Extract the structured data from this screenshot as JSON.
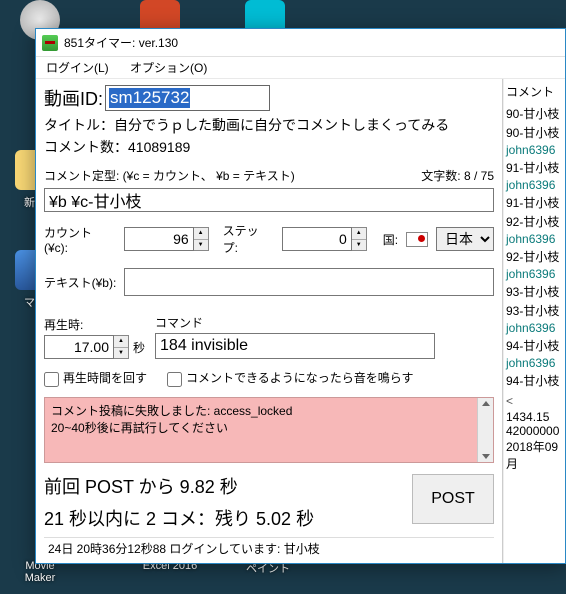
{
  "desktop": {
    "trash": "",
    "ppt": "",
    "newfolder": "新し",
    "mycomp": "マイ",
    "moviemaker": "Movie Maker",
    "excel": "Excel 2016",
    "paint": "ペイント"
  },
  "window": {
    "title": "851タイマー: ver.130"
  },
  "menu": {
    "login": "ログイン(L)",
    "option": "オプション(O)"
  },
  "main": {
    "video_id_label": "動画ID:",
    "video_id": "sm125732",
    "title_line": "タイトル：自分でうｐした動画に自分でコメントしまくってみる",
    "comment_count_line": "コメント数：41089189",
    "template_label": "コメント定型: (¥c = カウント、 ¥b = テキスト)",
    "char_count": "文字数: 8 / 75",
    "template_value": "¥b ¥c-甘小枝",
    "count_label": "カウント(¥c):",
    "count_value": "96",
    "step_label": "ステップ:",
    "step_value": "0",
    "country_label": "国:",
    "country_value": "日本",
    "text_label": "テキスト(¥b):",
    "text_value": "",
    "play_label": "再生時:",
    "play_value": "17.00",
    "seconds": "秒",
    "command_label": "コマンド",
    "command_value": "184 invisible",
    "chk_loop": "再生時間を回す",
    "chk_sound": "コメントできるようになったら音を鳴らす",
    "log1": "コメント投稿に失敗しました: access_locked",
    "log2": "20~40秒後に再試行してください",
    "status_prev": "前回 POST から 9.82 秒",
    "status_next": "21 秒以内に 2 コメ：残り 5.02 秒",
    "post_button": "POST",
    "statusbar": "24日 20時36分12秒88 ログインしています: 甘小枝"
  },
  "side": {
    "header": "コメント",
    "items": [
      {
        "t": "90-甘小枝",
        "c": "u1"
      },
      {
        "t": "90-甘小枝",
        "c": "u1"
      },
      {
        "t": "john6396",
        "c": "u2"
      },
      {
        "t": "91-甘小枝",
        "c": "u1"
      },
      {
        "t": "john6396",
        "c": "u2"
      },
      {
        "t": "91-甘小枝",
        "c": "u1"
      },
      {
        "t": "92-甘小枝",
        "c": "u1"
      },
      {
        "t": "john6396",
        "c": "u2"
      },
      {
        "t": "92-甘小枝",
        "c": "u1"
      },
      {
        "t": "john6396",
        "c": "u2"
      },
      {
        "t": "93-甘小枝",
        "c": "u1"
      },
      {
        "t": "93-甘小枝",
        "c": "u1"
      },
      {
        "t": "john6396",
        "c": "u2"
      },
      {
        "t": "94-甘小枝",
        "c": "u1"
      },
      {
        "t": "john6396",
        "c": "u2"
      },
      {
        "t": "94-甘小枝",
        "c": "u1"
      }
    ],
    "bottom1": "1434.15",
    "bottom2": "42000000",
    "bottom3": "2018年09月"
  }
}
